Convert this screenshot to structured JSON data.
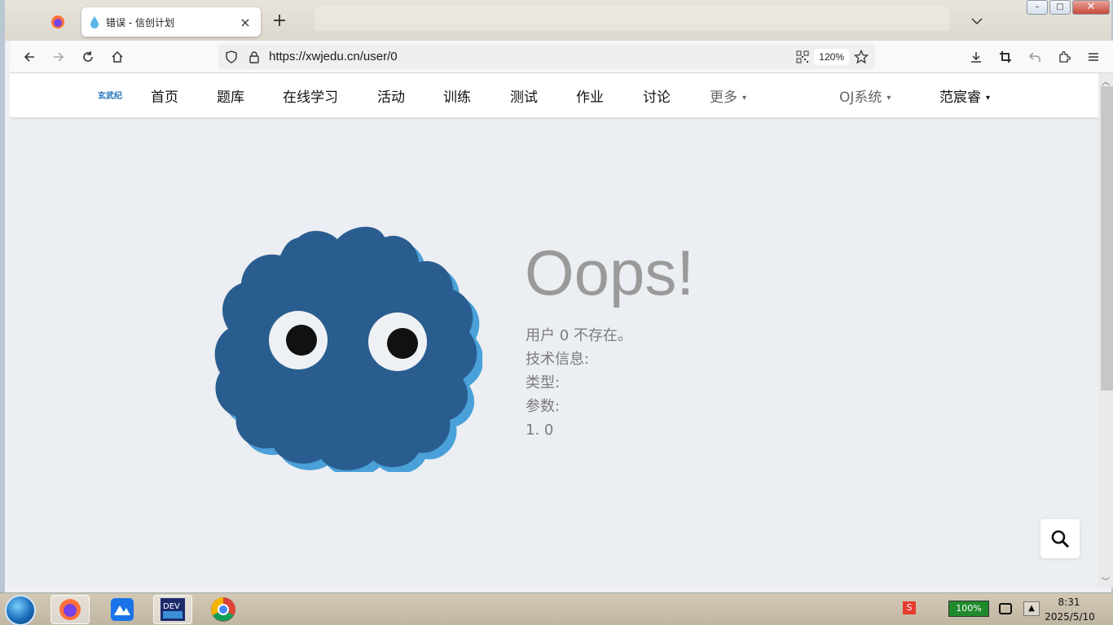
{
  "browser": {
    "tab_title": "错误 - 信创计划",
    "url": "https://xwjedu.cn/user/0",
    "zoom": "120%",
    "new_tab_label": "+",
    "tab_close_label": "×"
  },
  "site_nav": {
    "logo": "玄武纪",
    "items": [
      "首页",
      "题库",
      "在线学习",
      "活动",
      "训练",
      "测试",
      "作业",
      "讨论"
    ],
    "more_label": "更多",
    "oj_label": "OJ系统",
    "user_label": "范宸睿"
  },
  "error": {
    "title": "Oops!",
    "lines": [
      "用户 0 不存在。",
      "技术信息:",
      "类型:",
      "参数:",
      "1. 0"
    ]
  },
  "taskbar": {
    "battery": "100%",
    "time": "8:31",
    "date": "2025/5/10"
  },
  "colors": {
    "blob": "#2a5d8f",
    "blob_shadow": "#4aa0d8",
    "page_bg": "#ebeef2",
    "accent": "#1d6fb8"
  }
}
